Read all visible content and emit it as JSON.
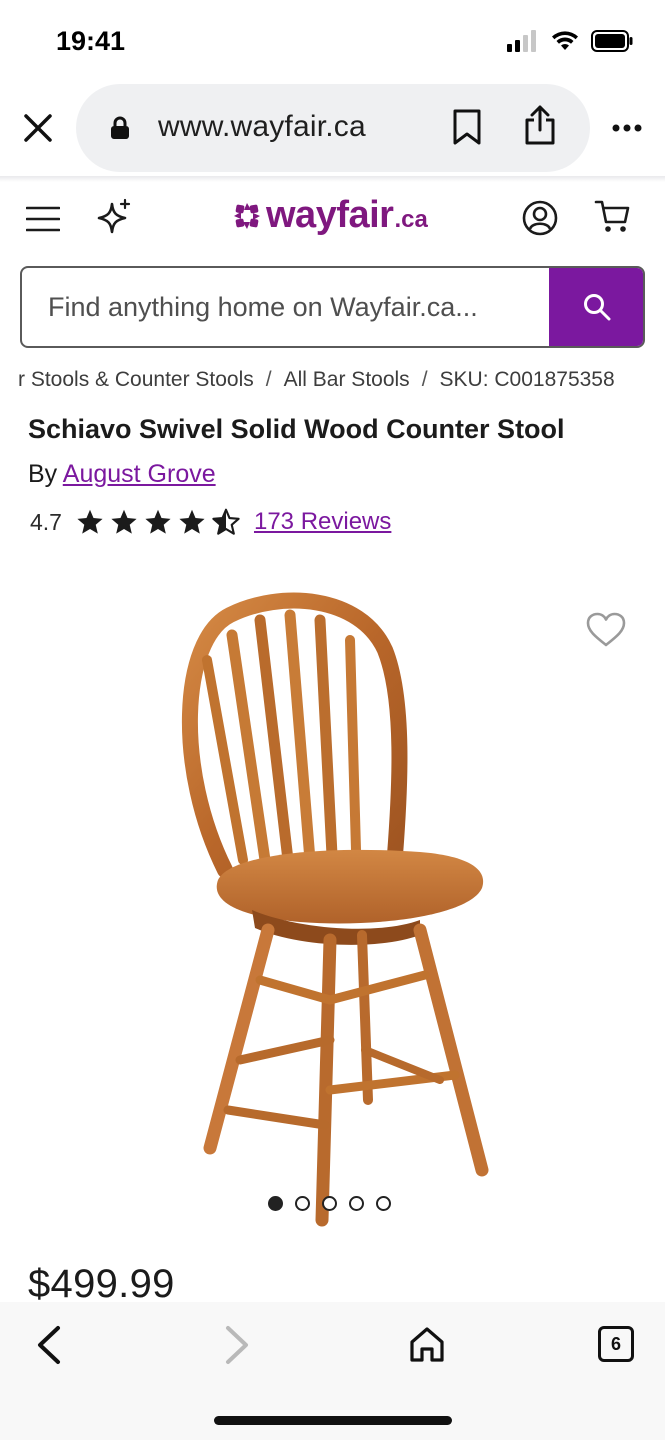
{
  "status_bar": {
    "time": "19:41",
    "icons": [
      "signal-icon",
      "wifi-icon",
      "battery-icon"
    ]
  },
  "browser": {
    "url": "www.wayfair.ca",
    "icons": [
      "close-icon",
      "lock-icon",
      "bookmark-icon",
      "share-icon",
      "more-icon"
    ]
  },
  "header": {
    "logo_word": "wayfair",
    "logo_tld": ".ca",
    "icons": [
      "menu-icon",
      "sparkle-icon",
      "account-icon",
      "cart-icon"
    ],
    "brand_color": "#7b189f"
  },
  "search": {
    "placeholder": "Find anything home on Wayfair.ca..."
  },
  "breadcrumb": {
    "items": [
      "r Stools & Counter Stools",
      "All Bar Stools",
      "SKU: C001875358"
    ],
    "separator": "/"
  },
  "product": {
    "title": "Schiavo Swivel Solid Wood Counter Stool",
    "by_label": "By",
    "brand": "August Grove",
    "rating": "4.7",
    "rating_stars": 4.5,
    "reviews": "173 Reviews",
    "price": "$499.99"
  },
  "gallery": {
    "image_count": 5,
    "active_index": 0
  },
  "bottom_bar": {
    "tab_count": "6",
    "icons": [
      "back-icon",
      "forward-icon",
      "home-icon",
      "tabs-icon"
    ]
  }
}
